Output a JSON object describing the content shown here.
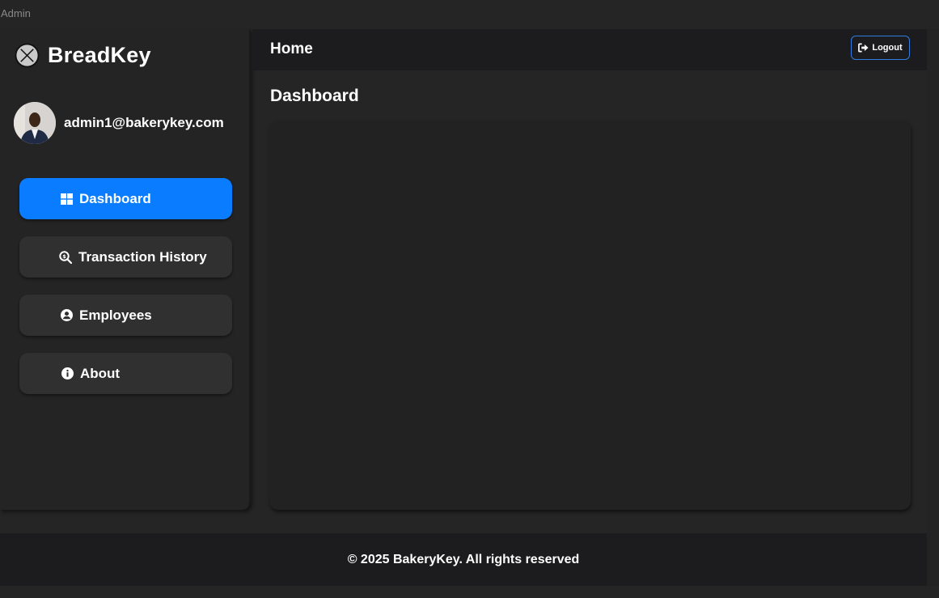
{
  "window": {
    "title": "Admin"
  },
  "brand": {
    "name": "BreadKey",
    "logo_icon": "x-circle-icon"
  },
  "user": {
    "email": "admin1@bakerykey.com",
    "avatar": "user-photo"
  },
  "nav": {
    "items": [
      {
        "label": "Dashboard",
        "icon": "grid-icon",
        "active": true
      },
      {
        "label": "Transaction History",
        "icon": "search-dollar-icon",
        "active": false
      },
      {
        "label": "Employees",
        "icon": "user-circle-icon",
        "active": false
      },
      {
        "label": "About",
        "icon": "info-circle-icon",
        "active": false
      }
    ]
  },
  "topbar": {
    "title": "Home",
    "logout_label": "Logout",
    "logout_icon": "sign-out-icon"
  },
  "main": {
    "heading": "Dashboard"
  },
  "footer": {
    "text": "© 2025 BakeryKey. All rights reserved"
  },
  "colors": {
    "accent": "#0a7cff",
    "background": "#252526",
    "panel": "#242424",
    "button": "#303030",
    "logout_border": "#2e7de3"
  }
}
